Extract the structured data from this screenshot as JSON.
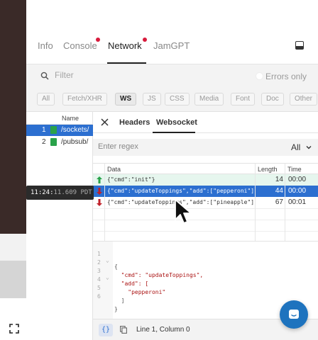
{
  "devtools": {
    "tabs": [
      {
        "label": "Info",
        "active": false,
        "badge": false
      },
      {
        "label": "Console",
        "active": false,
        "badge": true
      },
      {
        "label": "Network",
        "active": true,
        "badge": true
      },
      {
        "label": "JamGPT",
        "active": false,
        "badge": false
      }
    ],
    "badge_color": "#d81b3c"
  },
  "filter": {
    "placeholder": "Filter",
    "errors_only_label": "Errors only"
  },
  "type_filters": [
    {
      "label": "All",
      "active": false
    },
    {
      "label": "Fetch/XHR",
      "active": false
    },
    {
      "label": "WS",
      "active": true
    },
    {
      "label": "JS",
      "active": false
    },
    {
      "label": "CSS",
      "active": false
    },
    {
      "label": "Media",
      "active": false
    },
    {
      "label": "Font",
      "active": false
    },
    {
      "label": "Doc",
      "active": false
    },
    {
      "label": "Other",
      "active": false
    }
  ],
  "requests": {
    "header": "Name",
    "rows": [
      {
        "num": "1",
        "name": "/sockets/",
        "selected": true
      },
      {
        "num": "2",
        "name": "/pubsub/",
        "selected": false
      }
    ]
  },
  "timestamp": {
    "main": "11:24:",
    "dim": "11.609 PDT"
  },
  "detail": {
    "tabs": [
      "Headers",
      "Websocket"
    ],
    "active_tab": "Websocket",
    "regex_placeholder": "Enter regex",
    "direction_select": "All",
    "columns": {
      "data": "Data",
      "length": "Length",
      "time": "Time"
    },
    "messages": [
      {
        "direction": "sent",
        "data": "{\"cmd\":\"init\"}",
        "length": "14",
        "time": "00:00",
        "selected": false
      },
      {
        "direction": "received",
        "data": "{\"cmd\":\"updateToppings\",\"add\":[\"pepperoni\"]}",
        "length": "44",
        "time": "00:00",
        "selected": true
      },
      {
        "direction": "received",
        "data": "{\"cmd\":\"updateToppings\",\"add\":[\"pineapple\"]}",
        "length": "67",
        "time": "00:01",
        "selected": false
      }
    ],
    "code_lines": [
      {
        "num": "1",
        "fold": "⌄",
        "text": "{"
      },
      {
        "num": "2",
        "fold": "",
        "text": "  \"cmd\": \"updateToppings\","
      },
      {
        "num": "3",
        "fold": "⌄",
        "text": "  \"add\": ["
      },
      {
        "num": "4",
        "fold": "",
        "text": "    \"pepperoni\""
      },
      {
        "num": "5",
        "fold": "",
        "text": "  ]"
      },
      {
        "num": "6",
        "fold": "",
        "text": "}"
      }
    ],
    "pretty_print_label": "{}",
    "cursor_position": "Line 1, Column 0"
  },
  "colors": {
    "accent": "#2c6fd0",
    "sent_row": "#e6f6ee",
    "chat": "#1e73be",
    "received_arrow": "#c0202a",
    "sent_arrow": "#29a24a"
  }
}
